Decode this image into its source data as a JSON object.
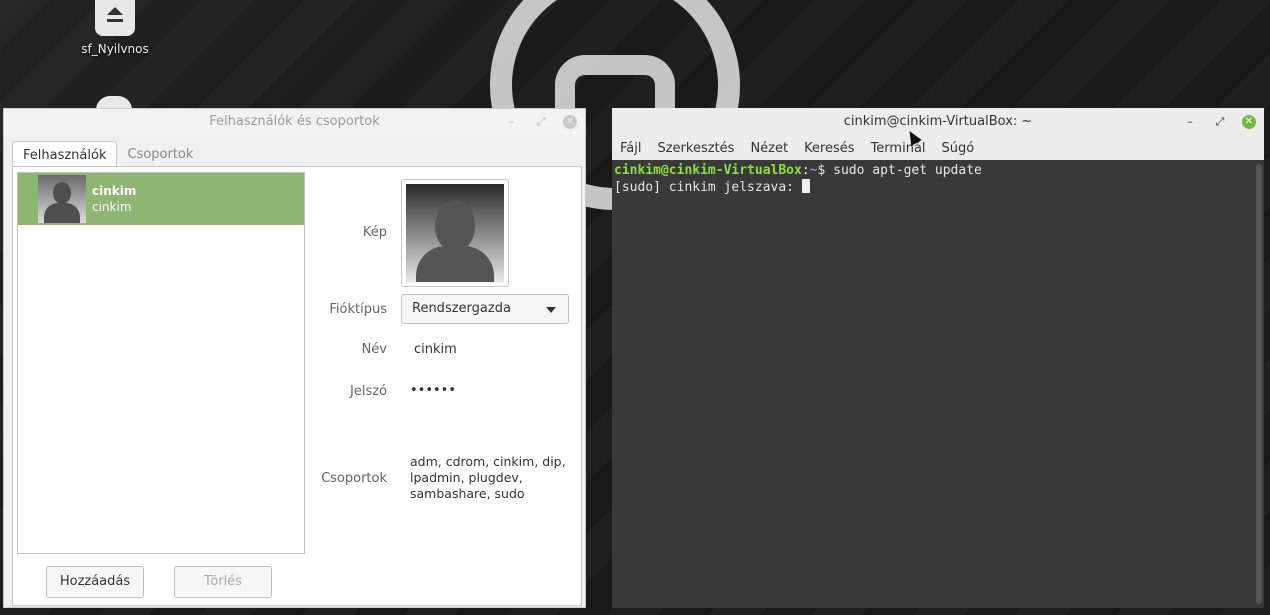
{
  "desktop": {
    "icon_label": "sf_Nyilvnos"
  },
  "users_window": {
    "title": "Felhasználók és csoportok",
    "tabs": [
      "Felhasználók",
      "Csoportok"
    ],
    "user": {
      "display_name": "cinkim",
      "username": "cinkim"
    },
    "labels": {
      "picture": "Kép",
      "account_type": "Fióktípus",
      "name": "Név",
      "password": "Jelszó",
      "groups": "Csoportok"
    },
    "values": {
      "account_type": "Rendszergazda",
      "name": "cinkim",
      "password": "••••••",
      "groups": "adm, cdrom, cinkim, dip, lpadmin, plugdev, sambashare, sudo"
    },
    "buttons": {
      "add": "Hozzáadás",
      "delete": "Törlés"
    },
    "colors": {
      "selection": "#8fb573"
    }
  },
  "terminal_window": {
    "title": "cinkim@cinkim-VirtualBox: ~",
    "menu": [
      "Fájl",
      "Szerkesztés",
      "Nézet",
      "Keresés",
      "Terminál",
      "Súgó"
    ],
    "line1": {
      "user_host": "cinkim@cinkim-VirtualBox",
      "sep": ":",
      "path": "~",
      "suffix": "$ sudo apt-get update"
    },
    "line2": "[sudo] cinkim jelszava: ",
    "colors": {
      "prompt_user": "#8ae234",
      "prompt_path": "#729fcf",
      "close": "#6dba4a"
    }
  }
}
